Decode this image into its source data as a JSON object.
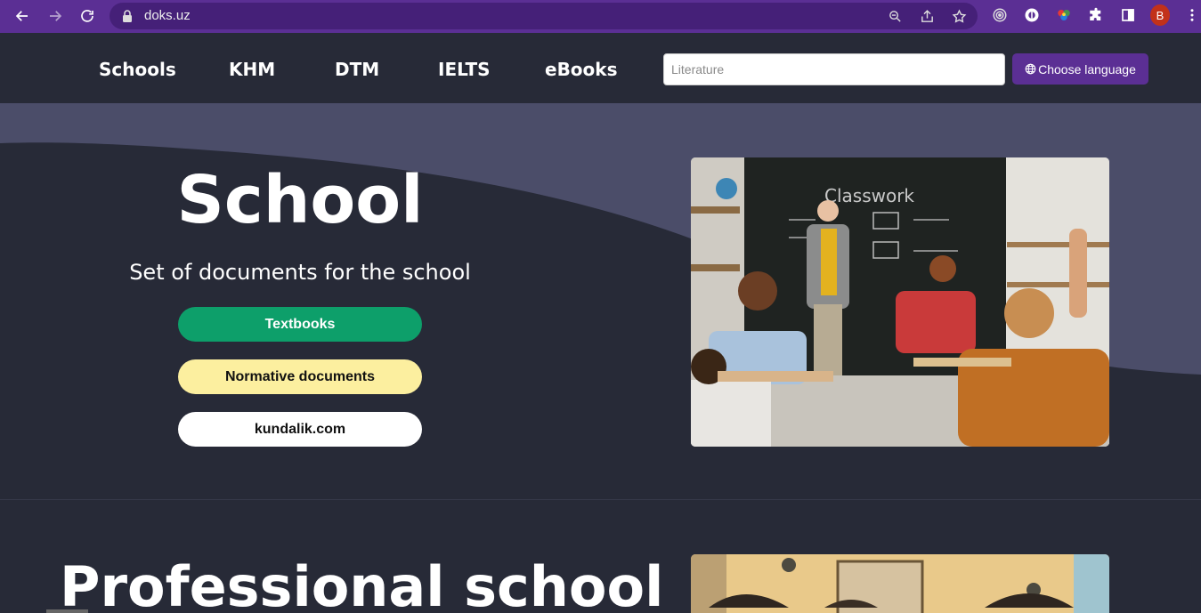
{
  "browser": {
    "url": "doks.uz",
    "avatar_letter": "B",
    "accent_color": "#5b2f94"
  },
  "header": {
    "nav_items": [
      "Schools",
      "KHM",
      "DTM",
      "IELTS",
      "eBooks"
    ],
    "search_placeholder": "Literature",
    "language_button": "Choose language"
  },
  "hero": {
    "title": "School",
    "subtitle": "Set of documents for the school",
    "buttons": [
      "Textbooks",
      "Normative documents",
      "kundalik.com"
    ],
    "button_colors": [
      "#0d9f6a",
      "#fcef9f",
      "#ffffff"
    ]
  },
  "section2": {
    "title": "Professional school"
  }
}
